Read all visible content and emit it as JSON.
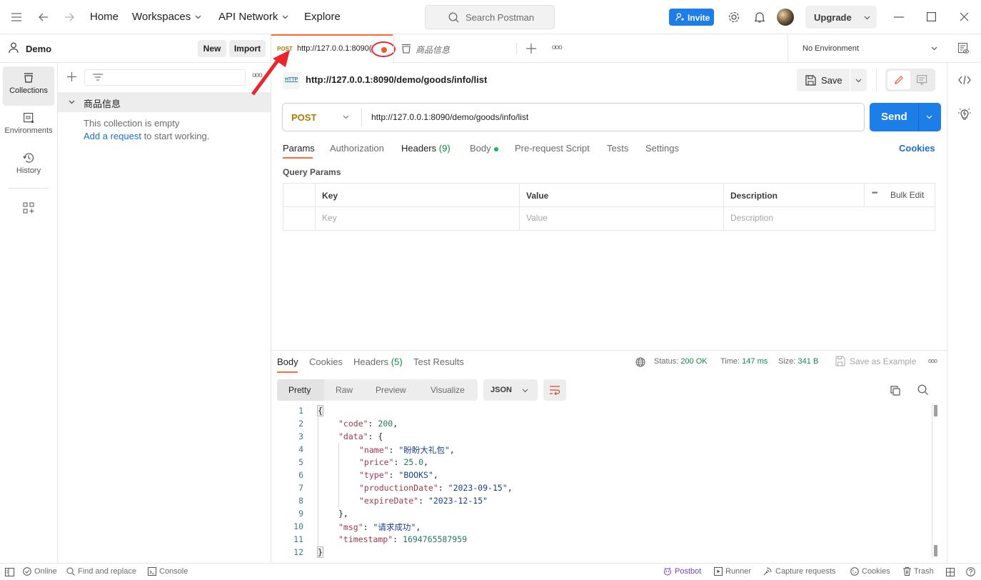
{
  "topbar": {
    "nav": [
      "Home",
      "Workspaces",
      "API Network",
      "Explore"
    ],
    "search_placeholder": "Search Postman",
    "invite_label": "Invite",
    "upgrade_label": "Upgrade"
  },
  "workspace": {
    "name": "Demo",
    "new_label": "New",
    "import_label": "Import"
  },
  "rail": [
    {
      "label": "Collections",
      "icon": "collections-icon",
      "active": true
    },
    {
      "label": "Environments",
      "icon": "environments-icon"
    },
    {
      "label": "History",
      "icon": "history-icon"
    }
  ],
  "sidebar": {
    "collection_name": "商品信息",
    "empty_text": "This collection is empty",
    "add_request_link": "Add a request",
    "add_request_suffix": " to start working."
  },
  "tabs": [
    {
      "method": "POST",
      "title": "http://127.0.0.1:8090(",
      "unsaved": true,
      "active": true
    },
    {
      "title": "商品信息",
      "icon": "collection-icon"
    }
  ],
  "environment": {
    "selected": "No Environment"
  },
  "request": {
    "name": "http://127.0.0.1:8090/demo/goods/info/list",
    "method": "POST",
    "url": "http://127.0.0.1:8090/demo/goods/info/list",
    "save_label": "Save",
    "send_label": "Send",
    "tabs": [
      {
        "label": "Params",
        "active": true
      },
      {
        "label": "Authorization"
      },
      {
        "label": "Headers",
        "count": "(9)"
      },
      {
        "label": "Body",
        "dot": true
      },
      {
        "label": "Pre-request Script"
      },
      {
        "label": "Tests"
      },
      {
        "label": "Settings"
      }
    ],
    "cookies_link": "Cookies",
    "query_params_title": "Query Params",
    "table": {
      "headers": [
        "Key",
        "Value",
        "Description"
      ],
      "placeholders": [
        "Key",
        "Value",
        "Description"
      ],
      "bulk_edit": "Bulk Edit"
    }
  },
  "response": {
    "tabs": [
      {
        "label": "Body",
        "active": true
      },
      {
        "label": "Cookies"
      },
      {
        "label": "Headers",
        "count": "(5)"
      },
      {
        "label": "Test Results"
      }
    ],
    "status_label": "Status:",
    "status_value": "200 OK",
    "time_label": "Time:",
    "time_value": "147 ms",
    "size_label": "Size:",
    "size_value": "341 B",
    "save_example": "Save as Example",
    "views": [
      "Pretty",
      "Raw",
      "Preview",
      "Visualize"
    ],
    "format": "JSON",
    "lines": [
      "1",
      "2",
      "3",
      "4",
      "5",
      "6",
      "7",
      "8",
      "9",
      "10",
      "11",
      "12"
    ],
    "json": {
      "code_key": "\"code\"",
      "code_val": "200",
      "data_key": "\"data\"",
      "name_key": "\"name\"",
      "name_val": "\"盼盼大礼包\"",
      "price_key": "\"price\"",
      "price_val": "25.0",
      "type_key": "\"type\"",
      "type_val": "\"BOOKS\"",
      "pd_key": "\"productionDate\"",
      "pd_val": "\"2023-09-15\"",
      "ed_key": "\"expireDate\"",
      "ed_val": "\"2023-12-15\"",
      "msg_key": "\"msg\"",
      "msg_val": "\"请求成功\"",
      "ts_key": "\"timestamp\"",
      "ts_val": "1694765587959"
    }
  },
  "statusbar": {
    "online": "Online",
    "find": "Find and replace",
    "console": "Console",
    "postbot": "Postbot",
    "runner": "Runner",
    "capture": "Capture requests",
    "cookies": "Cookies",
    "trash": "Trash"
  },
  "colors": {
    "accent": "#ff6c37",
    "primary": "#1d7ee8",
    "post": "#ad7a03",
    "success": "#0f8a4a",
    "annotation": "#e8262b"
  }
}
